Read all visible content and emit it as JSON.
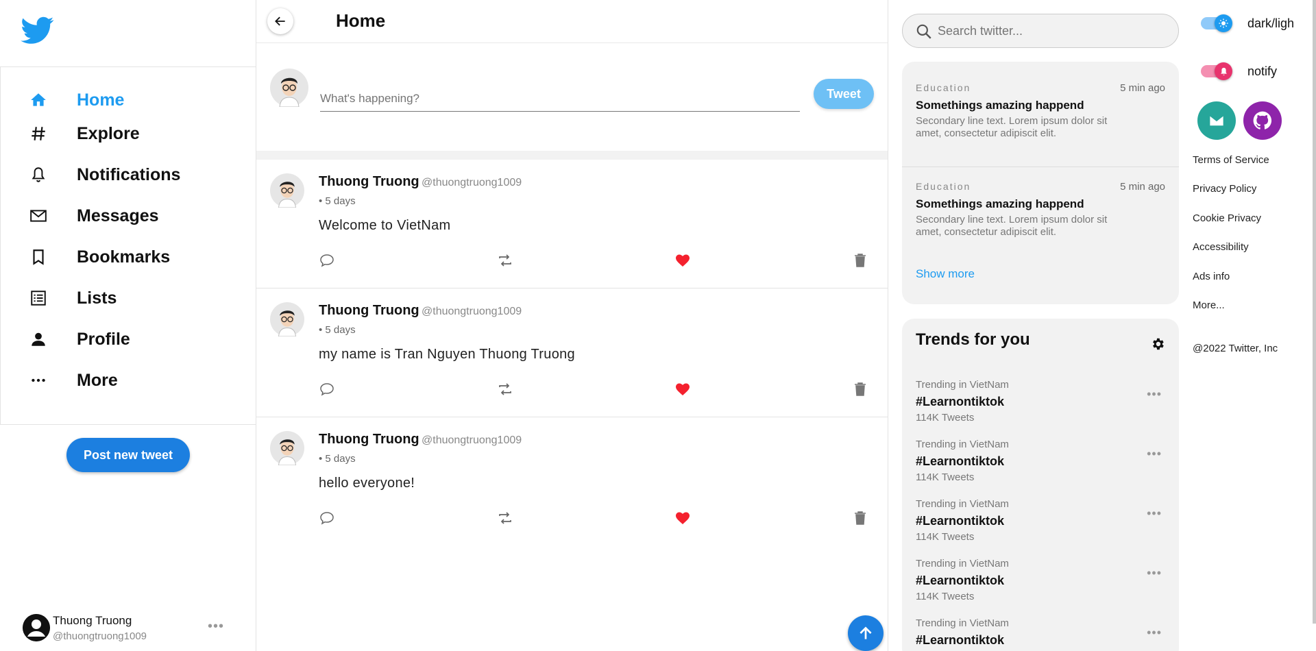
{
  "sidebar": {
    "logo": "twitter-bird-icon",
    "items": [
      {
        "label": "Home",
        "icon": "home-icon",
        "active": true
      },
      {
        "label": "Explore",
        "icon": "hashtag-icon"
      },
      {
        "label": "Notifications",
        "icon": "bell-icon"
      },
      {
        "label": "Messages",
        "icon": "mail-icon"
      },
      {
        "label": "Bookmarks",
        "icon": "bookmark-icon"
      },
      {
        "label": "Lists",
        "icon": "list-icon"
      },
      {
        "label": "Profile",
        "icon": "person-icon"
      },
      {
        "label": "More",
        "icon": "more-icon"
      }
    ],
    "post_button": "Post new tweet",
    "user": {
      "name": "Thuong Truong",
      "handle": "@thuongtruong1009",
      "more": "•••"
    }
  },
  "header": {
    "title": "Home"
  },
  "composer": {
    "placeholder": "What's happening?",
    "tweet_button": "Tweet"
  },
  "tweets": [
    {
      "name": "Thuong Truong",
      "handle": "@thuongtruong1009",
      "time": "• 5 days",
      "content": "Welcome to VietNam"
    },
    {
      "name": "Thuong Truong",
      "handle": "@thuongtruong1009",
      "time": "• 5 days",
      "content": "my name is Tran Nguyen Thuong Truong"
    },
    {
      "name": "Thuong Truong",
      "handle": "@thuongtruong1009",
      "time": "• 5 days",
      "content": "hello everyone!"
    }
  ],
  "search": {
    "placeholder": "Search twitter..."
  },
  "news": [
    {
      "category": "Education",
      "ago": "5 min ago",
      "title": "Somethings amazing happend",
      "body": "Secondary line text. Lorem ipsum dolor sit amet, consectetur adipiscit elit."
    },
    {
      "category": "Education",
      "ago": "5 min ago",
      "title": "Somethings amazing happend",
      "body": "Secondary line text. Lorem ipsum dolor sit amet, consectetur adipiscit elit."
    }
  ],
  "news_show_more": "Show more",
  "trends": {
    "title": "Trends for you",
    "items": [
      {
        "where": "Trending in VietNam",
        "tag": "#Learnontiktok",
        "count": "114K Tweets"
      },
      {
        "where": "Trending in VietNam",
        "tag": "#Learnontiktok",
        "count": "114K Tweets"
      },
      {
        "where": "Trending in VietNam",
        "tag": "#Learnontiktok",
        "count": "114K Tweets"
      },
      {
        "where": "Trending in VietNam",
        "tag": "#Learnontiktok",
        "count": "114K Tweets"
      },
      {
        "where": "Trending in VietNam",
        "tag": "#Learnontiktok",
        "count": ""
      }
    ]
  },
  "far_right": {
    "dark_toggle": "dark/ligh",
    "notify_toggle": "notify",
    "links": [
      "Terms of Service",
      "Privacy Policy",
      "Cookie Privacy",
      "Accessibility",
      "Ads info",
      "More..."
    ],
    "copyright": "@2022 Twitter, Inc"
  },
  "colors": {
    "accent": "#1d9bf0",
    "button_blue": "#1c7fe0",
    "like_red": "#f4212e",
    "notify_pink": "#e8336d",
    "mail_teal": "#26a69a",
    "github_purple": "#8e24aa"
  }
}
